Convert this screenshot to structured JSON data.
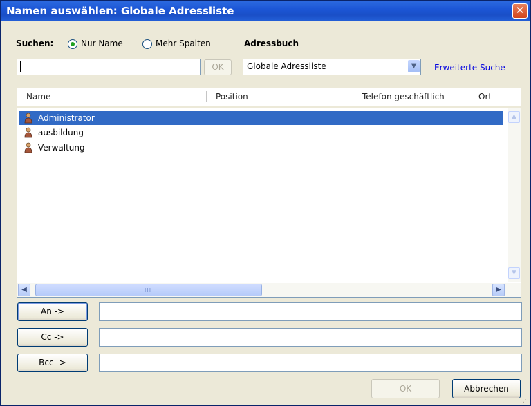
{
  "window": {
    "title": "Namen auswählen: Globale Adressliste",
    "close_glyph": "✕"
  },
  "search": {
    "label": "Suchen:",
    "radio_name_only": {
      "label": "Nur Name",
      "checked": true
    },
    "radio_more_columns": {
      "label": "Mehr Spalten",
      "checked": false
    },
    "input_value": "",
    "ok_label": "OK"
  },
  "addressbook": {
    "label": "Adressbuch",
    "selected": "Globale Adressliste",
    "advanced_search": "Erweiterte Suche"
  },
  "table": {
    "columns": [
      "Name",
      "Position",
      "Telefon geschäftlich",
      "Ort"
    ],
    "rows": [
      {
        "name": "Administrator",
        "selected": true,
        "icon": "person-icon"
      },
      {
        "name": "ausbildung",
        "selected": false,
        "icon": "person-icon"
      },
      {
        "name": "Verwaltung",
        "selected": false,
        "icon": "person-icon"
      }
    ],
    "hscroll_grip": "III"
  },
  "recipients": {
    "to_label": "An ->",
    "cc_label": "Cc ->",
    "bcc_label": "Bcc ->",
    "to_value": "",
    "cc_value": "",
    "bcc_value": ""
  },
  "footer": {
    "ok_label": "OK",
    "cancel_label": "Abbrechen"
  },
  "colors": {
    "selection": "#316ac5",
    "titlebar": "#1c56d6",
    "link": "#0000e0"
  }
}
